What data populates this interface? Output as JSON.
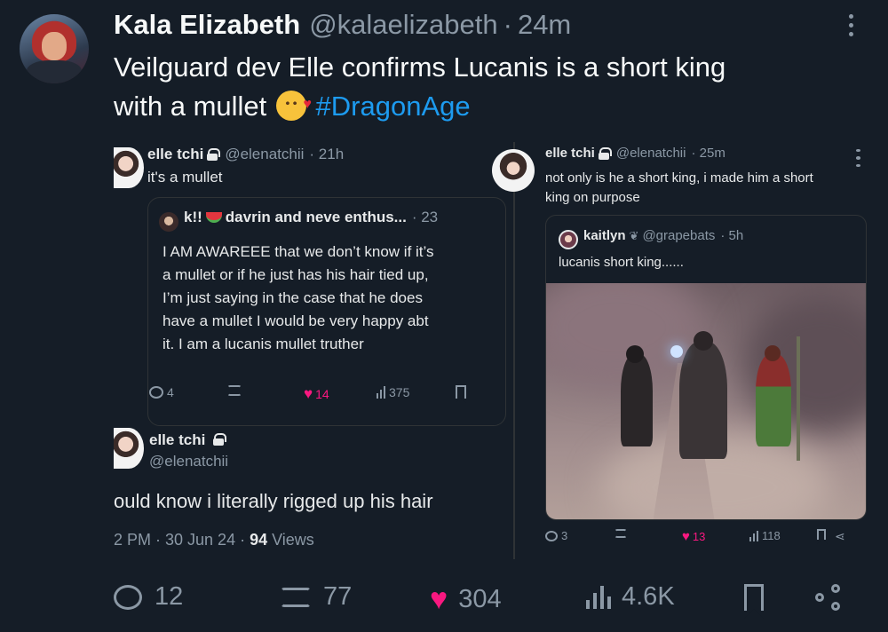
{
  "main": {
    "name": "Kala Elizabeth",
    "handle": "@kalaelizabeth",
    "separator": "·",
    "time": "24m",
    "text_line1": "Veilguard dev Elle confirms Lucanis is a short king",
    "text_line2_start": "with a mullet",
    "hashtag": "#DragonAge",
    "actions": {
      "replies": "12",
      "reposts": "77",
      "likes": "304",
      "views": "4.6K"
    }
  },
  "left_tweet": {
    "name": "elle tchi",
    "handle": "@elenatchii",
    "time": "· 21h",
    "text": "it's a mullet",
    "quote": {
      "name_prefix": "k!!",
      "name_suffix": "davrin and neve enthus...",
      "time": "· 23",
      "line1": "I AM AWAREEE that we don’t know if it’s",
      "line2": "a mullet or if he just has his hair tied up,",
      "line3": "I’m just saying in the case that he does",
      "line4": "have a mullet I would be very happy abt",
      "line5": "it. I am a lucanis mullet truther"
    },
    "actions": {
      "replies": "4",
      "likes": "14",
      "views": "375"
    }
  },
  "elle_reply": {
    "name": "elle tchi",
    "handle": "@elenatchii",
    "text": "ould know i literally rigged up his hair",
    "time_prefix": "2 PM · 30 Jun 24 · ",
    "views_count": "94",
    "views_label": " Views"
  },
  "right_tweet": {
    "name": "elle tchi",
    "handle": "@elenatchii",
    "time": "· 25m",
    "line1": "not only is he a short king, i made him a short",
    "line2": "king on purpose",
    "quote": {
      "name": "kaitlyn",
      "handle": "@grapebats",
      "time": "· 5h",
      "text": "lucanis short king......"
    },
    "actions": {
      "replies": "3",
      "likes": "13",
      "views": "118"
    }
  },
  "icons": {
    "reply": "reply-icon",
    "repost": "repost-icon",
    "like": "heart-icon",
    "views": "views-icon",
    "bookmark": "bookmark-icon",
    "share": "share-icon",
    "more": "more-icon"
  },
  "colors": {
    "background": "#151d27",
    "like_pink": "#f91880",
    "link_blue": "#1d9bf0",
    "muted": "#8b98a5"
  }
}
